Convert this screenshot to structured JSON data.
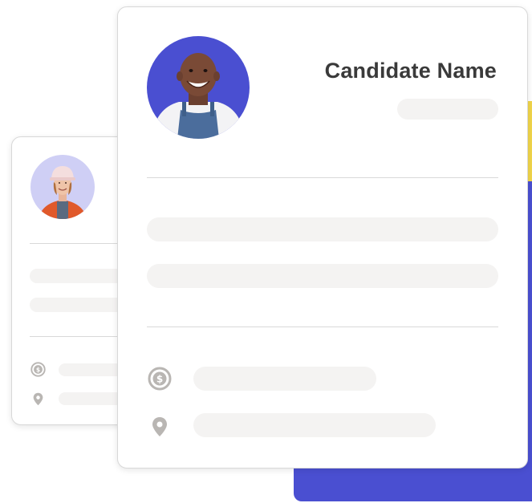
{
  "candidate_card": {
    "name": "Candidate Name"
  },
  "colors": {
    "accent_blue": "#4a4fd1",
    "accent_yellow": "#f1d54a",
    "skeleton": "#f4f3f2",
    "border": "#d8d8d8",
    "text": "#3a3a3a",
    "icon": "#b9b6b3"
  },
  "icons": {
    "salary": "dollar-coin-icon",
    "location": "location-pin-icon"
  }
}
